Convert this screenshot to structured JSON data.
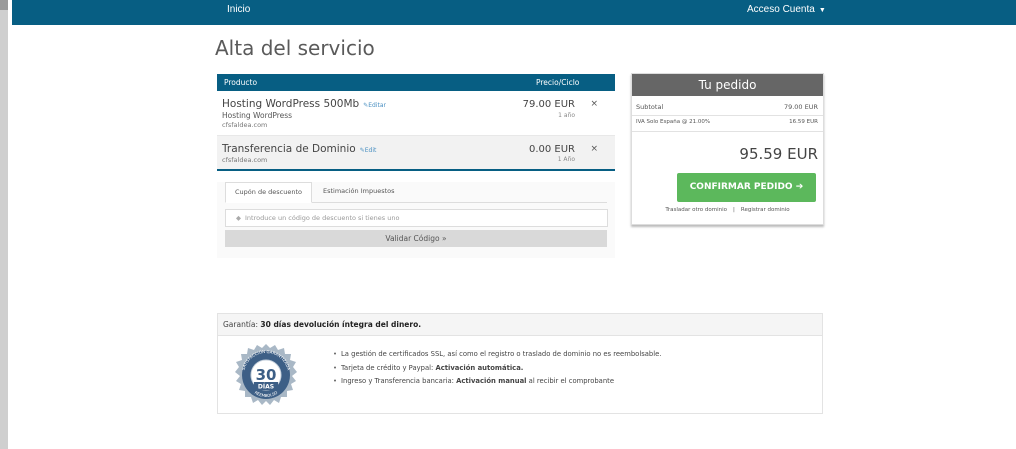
{
  "nav": {
    "home": "Inicio",
    "account": "Acceso Cuenta"
  },
  "page_title": "Alta del servicio",
  "cart": {
    "columns": {
      "product": "Producto",
      "price": "Precio/Ciclo"
    },
    "items": [
      {
        "name": "Hosting WordPress 500Mb",
        "edit": "Editar",
        "group": "Hosting WordPress",
        "domain": "cfsfaldea.com",
        "price": "79.00 EUR",
        "cycle": "1 año",
        "remove": "×"
      },
      {
        "name": "Transferencia de Dominio",
        "edit": "Edit",
        "domain": "cfsfaldea.com",
        "price": "0.00 EUR",
        "cycle": "1 Año",
        "remove": "×"
      }
    ]
  },
  "coupon": {
    "tab_discount": "Cupón de descuento",
    "tab_taxes": "Estimación Impuestos",
    "placeholder": "Introduce un código de descuento si tienes uno",
    "validate": "Validar Código »"
  },
  "order": {
    "title": "Tu pedido",
    "subtotal_label": "Subtotal",
    "subtotal_value": "79.00 EUR",
    "tax_label": "IVA Solo España @ 21.00%",
    "tax_value": "16.59 EUR",
    "total": "95.59 EUR",
    "confirm": "CONFIRMAR PEDIDO",
    "link_transfer": "Trasladar otro dominio",
    "link_register": "Registrar dominio"
  },
  "guarantee": {
    "prefix": "Garantía:",
    "highlight": "30 días devolución íntegra del dinero.",
    "badge_number": "30",
    "badge_word": "DÍAS",
    "badge_text_top": "SATISFACCIÓN GARANTIZADA",
    "badge_text_bottom": "REEMBOLSO",
    "items": [
      {
        "text": "La gestión de certificados SSL, así como el registro o traslado de dominio no es reembolsable.",
        "bold": ""
      },
      {
        "text": "Tarjeta de crédito y Paypal: ",
        "bold": "Activación automática."
      },
      {
        "text": "Ingreso y Transferencia bancaria: ",
        "bold": "Activación manual",
        "after": " al recibir el comprobante"
      }
    ]
  }
}
